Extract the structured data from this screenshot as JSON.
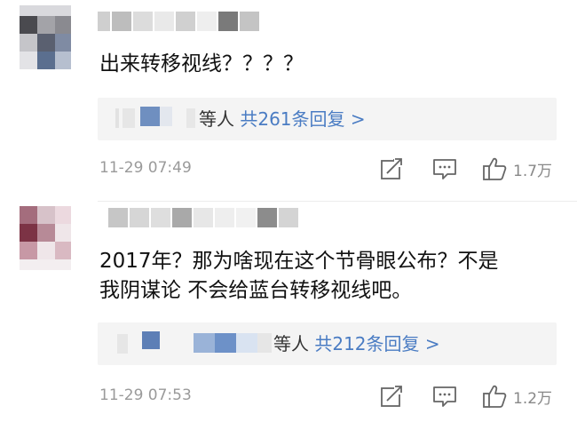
{
  "comments": [
    {
      "body_lines": [
        "出来转移视线？？？？"
      ],
      "reply_summary": "等人",
      "reply_link": "共261条回复 >",
      "time": "11-29 07:49",
      "likes": "1.7万"
    },
    {
      "body_lines": [
        "2017年？那为啥现在这个节骨眼公布？不是",
        "我阴谋论 不会给蓝台转移视线吧。"
      ],
      "reply_summary": "等人",
      "reply_link": "共212条回复 >",
      "time": "11-29 07:53",
      "likes": "1.2万"
    }
  ],
  "icons": {
    "share": "share-icon",
    "comment": "comment-icon",
    "like": "thumbs-up-icon"
  },
  "colors": {
    "reply_link": "#4a7cc3",
    "text": "#111111",
    "meta": "#9a9a9a",
    "reply_bg": "#f4f4f4"
  }
}
